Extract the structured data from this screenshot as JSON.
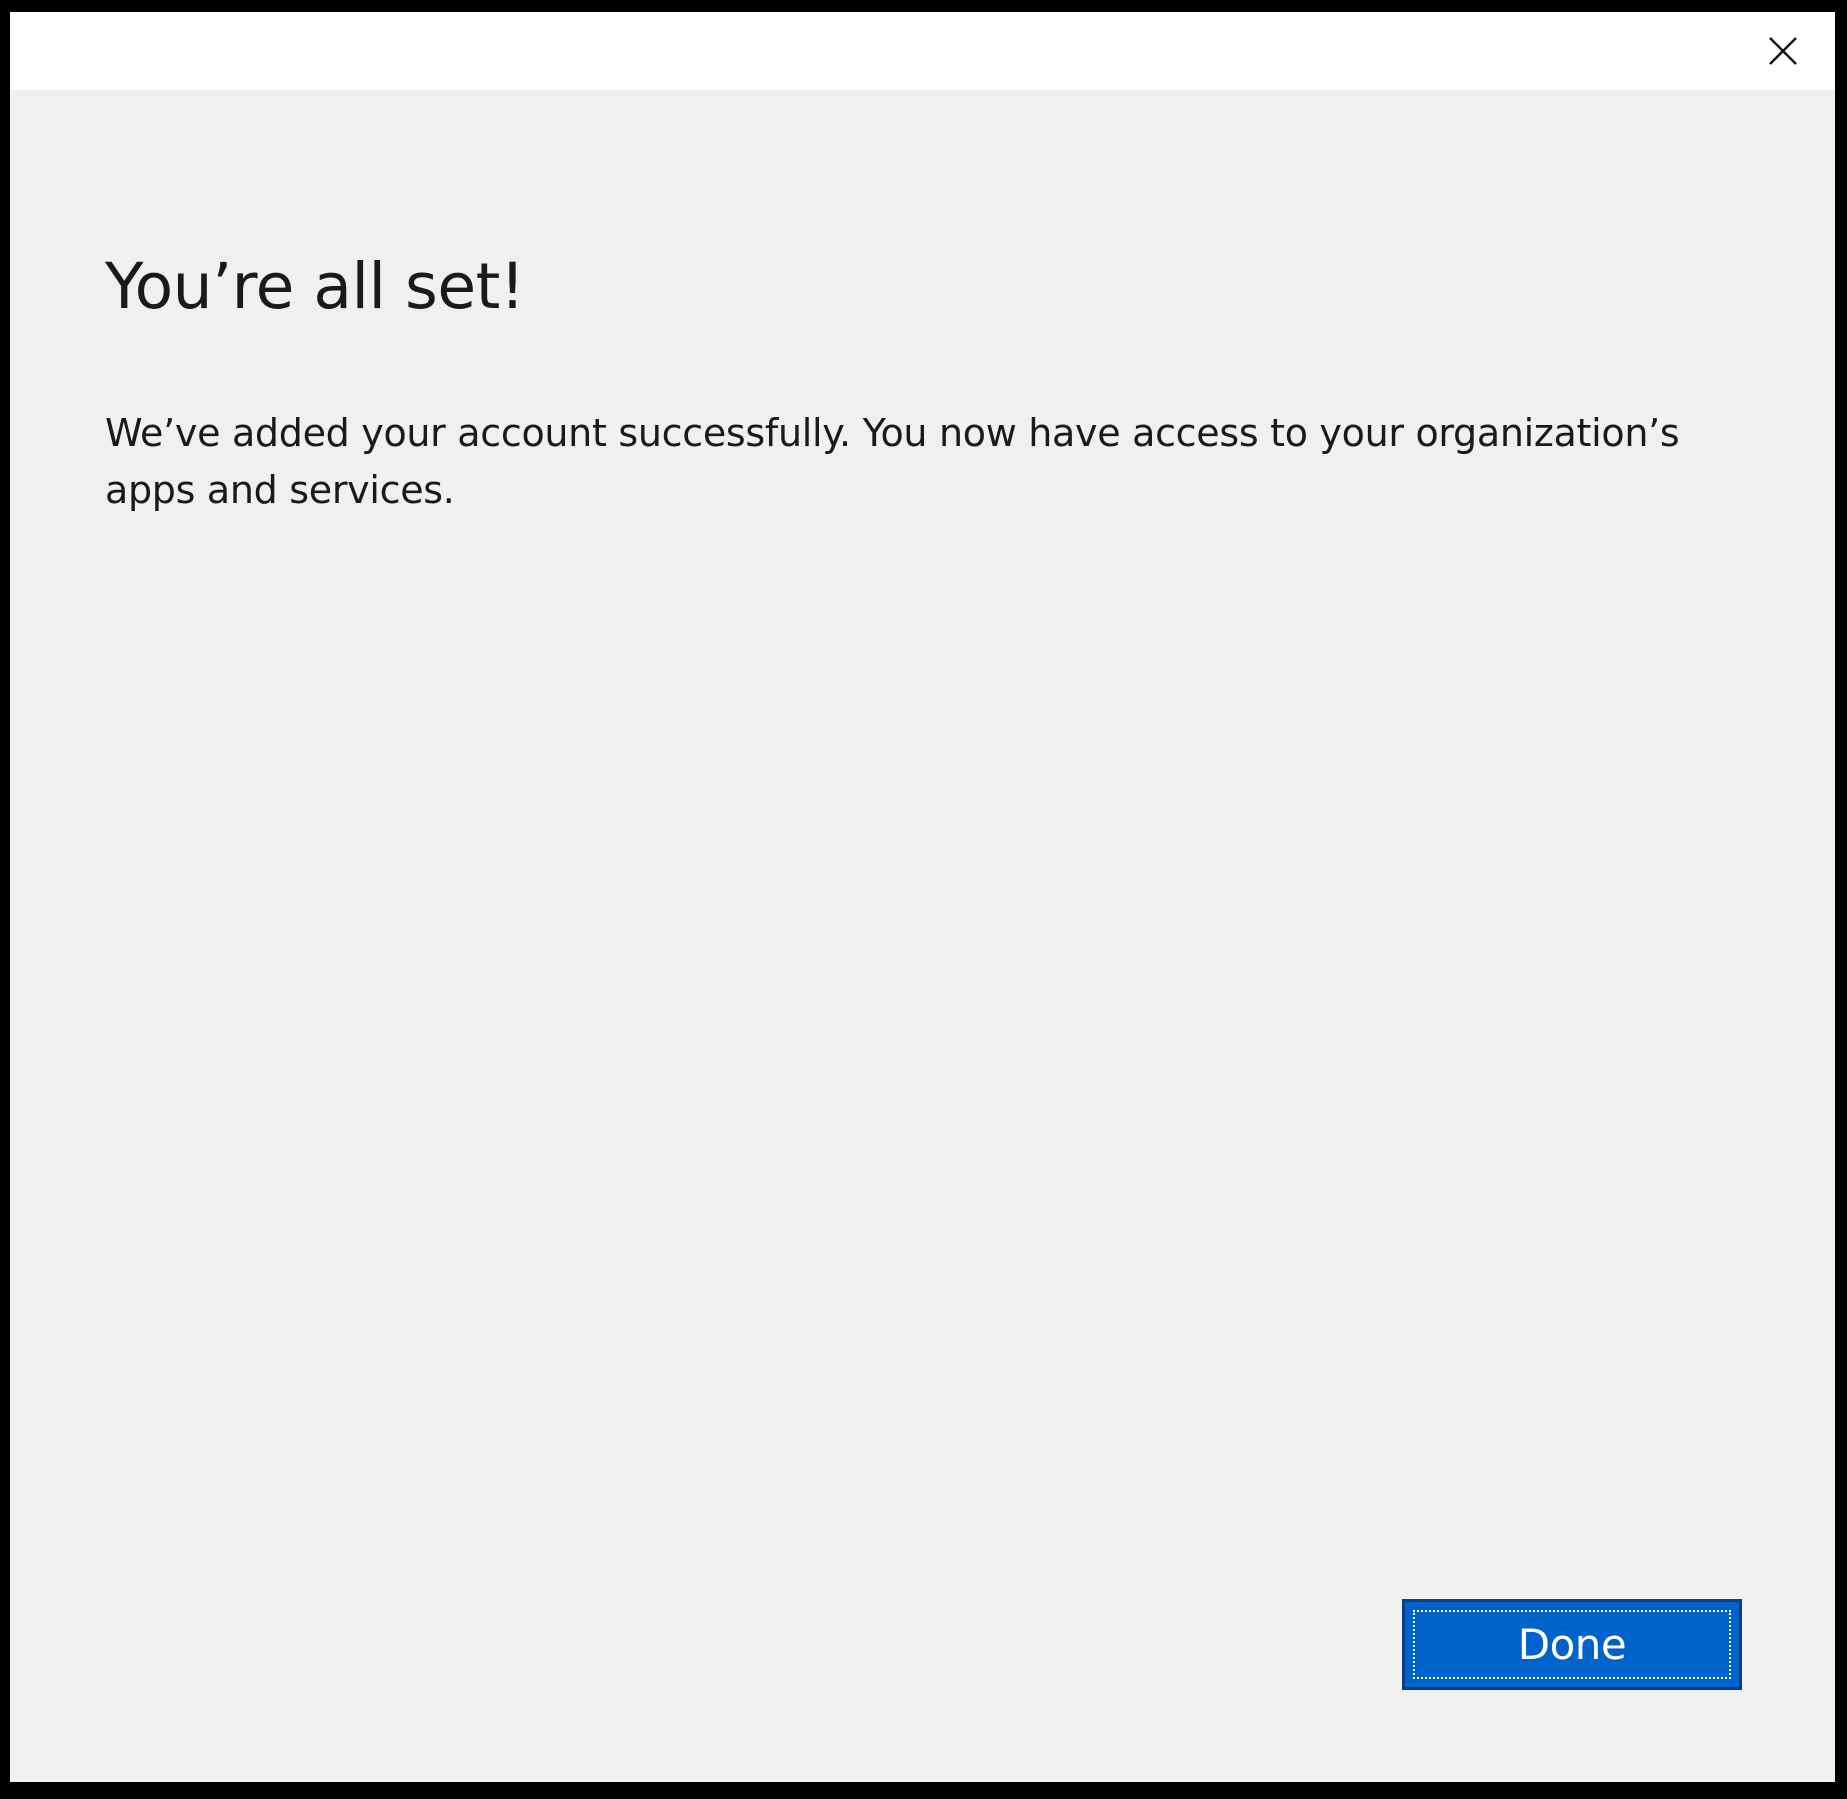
{
  "dialog": {
    "close_icon": "close-icon",
    "heading": "You’re all set!",
    "message": "We’ve added your account successfully. You now have access to your organization’s apps and services.",
    "done_label": "Done"
  },
  "colors": {
    "frame": "#000000",
    "title_bar": "#ffffff",
    "content_background": "#f0f0f0",
    "text": "#1a1a1a",
    "primary_button": "#0063cc",
    "primary_button_border": "#0a3f82",
    "primary_button_text": "#ffffff"
  }
}
